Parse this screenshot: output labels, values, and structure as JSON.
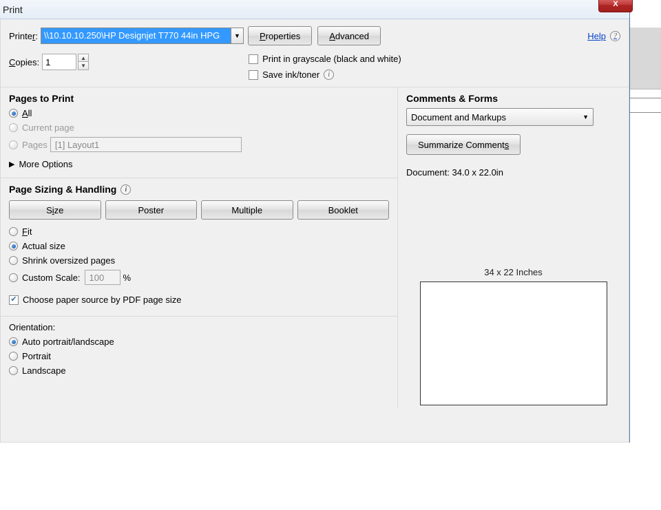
{
  "title": "Print",
  "help": "Help",
  "printer": {
    "label": "Printer:",
    "selected": "\\\\10.10.10.250\\HP Designjet T770 44in HPG",
    "properties": "Properties",
    "advanced": "Advanced"
  },
  "copies": {
    "label": "Copies:",
    "value": "1"
  },
  "opts": {
    "grayscale": "Print in grayscale (black and white)",
    "saveink": "Save ink/toner"
  },
  "pages": {
    "title": "Pages to Print",
    "all": "All",
    "current": "Current page",
    "range_label": "Pages",
    "range_value": "[1] Layout1",
    "more": "More Options"
  },
  "sizing": {
    "title": "Page Sizing & Handling",
    "btns": {
      "size": "Size",
      "poster": "Poster",
      "multiple": "Multiple",
      "booklet": "Booklet"
    },
    "fit": "Fit",
    "actual": "Actual size",
    "shrink": "Shrink oversized pages",
    "custom": "Custom Scale:",
    "custom_val": "100",
    "pct": "%",
    "papersrc": "Choose paper source by PDF page size"
  },
  "orient": {
    "title": "Orientation:",
    "auto": "Auto portrait/landscape",
    "portrait": "Portrait",
    "landscape": "Landscape"
  },
  "cf": {
    "title": "Comments & Forms",
    "selected": "Document and Markups",
    "summarize": "Summarize Comments",
    "docdim": "Document: 34.0 x 22.0in",
    "preview_label": "34 x 22 Inches"
  }
}
